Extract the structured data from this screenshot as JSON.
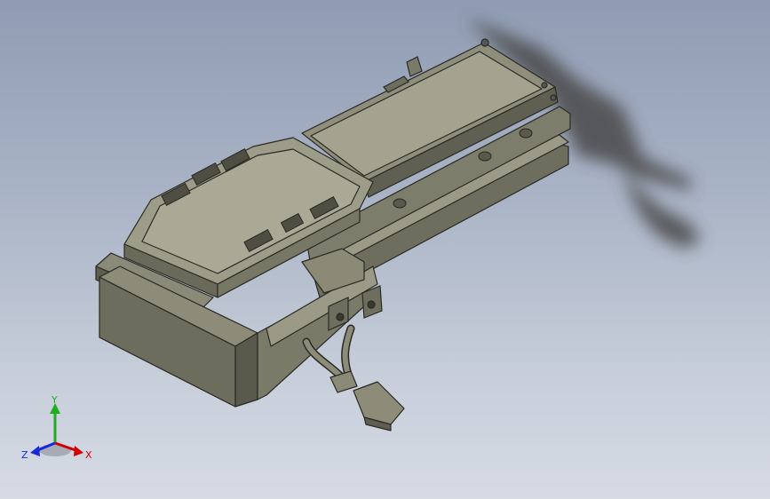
{
  "view": {
    "background_top": "#8f9cb3",
    "background_bottom": "#d6dbe4",
    "model_color": "#8a8a78"
  },
  "triad": {
    "x_label": "X",
    "y_label": "Y",
    "z_label": "Z",
    "x_color": "#d40000",
    "y_color": "#1fae1f",
    "z_color": "#1a28d6"
  }
}
